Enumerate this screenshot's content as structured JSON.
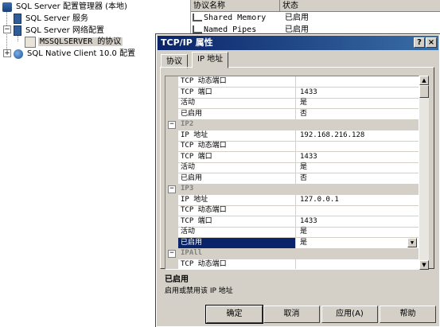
{
  "tree": {
    "root": "SQL Server 配置管理器 (本地)",
    "services": "SQL Server 服务",
    "network_config": "SQL Server 网络配置",
    "protocols": "MSSQLSERVER 的协议",
    "native_client": "SQL Native Client 10.0 配置",
    "expand_minus": "−",
    "expand_plus": "+"
  },
  "list": {
    "col_name": "协议名称",
    "col_status": "状态",
    "rows": [
      {
        "name": "Shared Memory",
        "status": "已启用"
      },
      {
        "name": "Named Pipes",
        "status": "已启用"
      }
    ]
  },
  "dialog": {
    "title": "TCP/IP 属性",
    "help_btn": "?",
    "close_btn": "×",
    "tabs": [
      "协议",
      "IP 地址"
    ],
    "active_tab": 1,
    "grid": [
      {
        "type": "prop",
        "key": "TCP 动态端口",
        "value": ""
      },
      {
        "type": "prop",
        "key": "TCP 端口",
        "value": "1433"
      },
      {
        "type": "prop",
        "key": "活动",
        "value": "是"
      },
      {
        "type": "prop",
        "key": "已启用",
        "value": "否"
      },
      {
        "type": "cat",
        "key": "IP2"
      },
      {
        "type": "prop",
        "key": "IP 地址",
        "value": "192.168.216.128"
      },
      {
        "type": "prop",
        "key": "TCP 动态端口",
        "value": ""
      },
      {
        "type": "prop",
        "key": "TCP 端口",
        "value": "1433"
      },
      {
        "type": "prop",
        "key": "活动",
        "value": "是"
      },
      {
        "type": "prop",
        "key": "已启用",
        "value": "否"
      },
      {
        "type": "cat",
        "key": "IP3"
      },
      {
        "type": "prop",
        "key": "IP 地址",
        "value": "127.0.0.1"
      },
      {
        "type": "prop",
        "key": "TCP 动态端口",
        "value": ""
      },
      {
        "type": "prop",
        "key": "TCP 端口",
        "value": "1433"
      },
      {
        "type": "prop",
        "key": "活动",
        "value": "是"
      },
      {
        "type": "prop",
        "key": "已启用",
        "value": "是",
        "selected": true
      },
      {
        "type": "cat",
        "key": "IPAll"
      },
      {
        "type": "prop",
        "key": "TCP 动态端口",
        "value": ""
      }
    ],
    "description": {
      "title": "已启用",
      "text": "启用或禁用该 IP 地址"
    },
    "buttons": {
      "ok": "确定",
      "cancel": "取消",
      "apply": "应用(A)",
      "help": "帮助"
    },
    "colors": {
      "titlebar": "#0a246a",
      "selection": "#0a246a",
      "face": "#d4d0c8"
    }
  }
}
